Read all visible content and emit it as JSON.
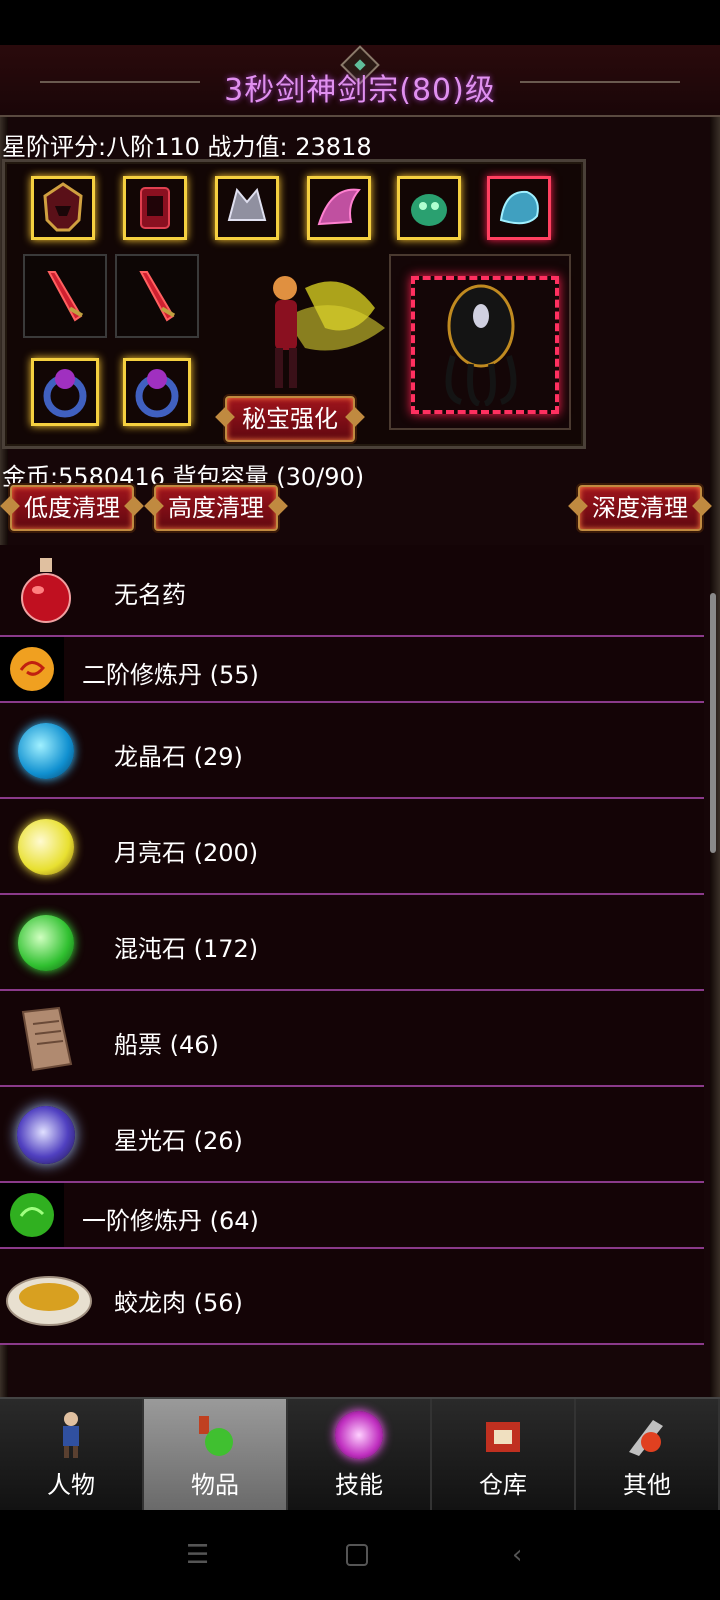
{
  "header": {
    "title": "3秒剑神剑宗(80)级"
  },
  "stats": {
    "rating": "星阶评分:八阶110 战力值: 23818"
  },
  "equipment": {
    "treasure_button": "秘宝强化"
  },
  "inventory": {
    "gold_capacity": "金币:5580416 背包容量 (30/90)",
    "clear_low": "低度清理",
    "clear_high": "高度清理",
    "clear_deep": "深度清理",
    "items": [
      {
        "name": "无名药",
        "icon": "red-potion-icon"
      },
      {
        "name": "二阶修炼丹 (55)",
        "icon": "orange-pill-icon"
      },
      {
        "name": "龙晶石 (29)",
        "icon": "blue-orb-icon"
      },
      {
        "name": "月亮石 (200)",
        "icon": "yellow-orb-icon"
      },
      {
        "name": "混沌石 (172)",
        "icon": "green-orb-icon"
      },
      {
        "name": "船票 (46)",
        "icon": "scroll-icon"
      },
      {
        "name": "星光石 (26)",
        "icon": "purple-orb-icon"
      },
      {
        "name": "一阶修炼丹 (64)",
        "icon": "green-pill-icon"
      },
      {
        "name": "蛟龙肉 (56)",
        "icon": "dragon-meat-icon"
      }
    ]
  },
  "tabs": [
    {
      "label": "人物",
      "icon": "character-icon"
    },
    {
      "label": "物品",
      "icon": "potion-bag-icon"
    },
    {
      "label": "技能",
      "icon": "skill-orb-icon"
    },
    {
      "label": "仓库",
      "icon": "warehouse-icon"
    },
    {
      "label": "其他",
      "icon": "other-icon"
    }
  ],
  "colors": {
    "title": "#e090f0",
    "row_divider": "#8a3a8a",
    "button_red": "#a0141c",
    "active_tab": "#8a8a8a"
  }
}
